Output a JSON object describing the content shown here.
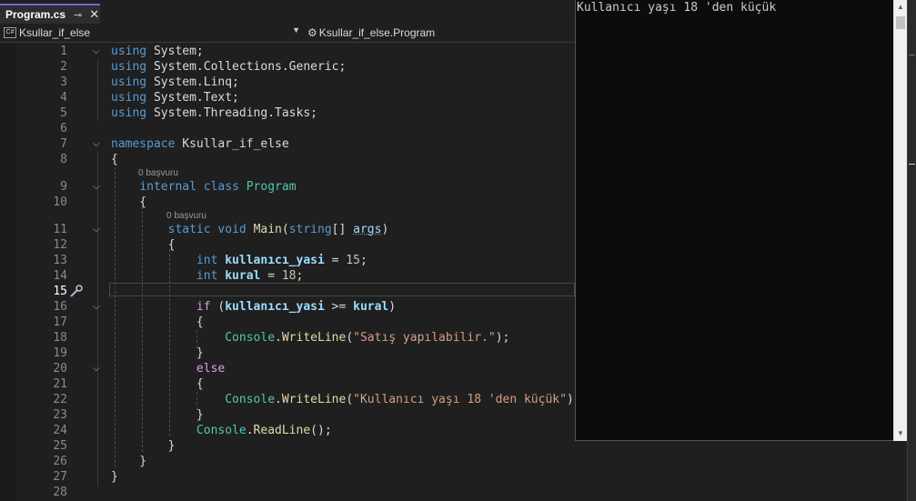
{
  "tab": {
    "title": "Program.cs",
    "pin_icon": "pin-icon",
    "close_label": "✕"
  },
  "nav": {
    "project": "Ksullar_if_else",
    "member": "Ksullar_if_else.Program"
  },
  "lens": {
    "refs": "0 başvuru"
  },
  "code": {
    "using": "using",
    "lines_using": [
      "System;",
      "System.Collections.Generic;",
      "System.Linq;",
      "System.Text;",
      "System.Threading.Tasks;"
    ],
    "namespace_kw": "namespace",
    "namespace_name": "Ksullar_if_else",
    "internal_kw": "internal",
    "class_kw": "class",
    "class_name": "Program",
    "static_kw": "static",
    "void_kw": "void",
    "main": "Main",
    "string_kw": "string",
    "args": "args",
    "int_kw": "int",
    "var1": "kullanıcı_yasi",
    "val1": "15",
    "var2": "kural",
    "val2": "18",
    "if_kw": "if",
    "op": ">=",
    "else_kw": "else",
    "console": "Console",
    "writeline": "WriteLine",
    "readline": "ReadLine",
    "str1": "\"Satış yapılabilir.\"",
    "str2": "\"Kullanıcı yaşı 18 'den küçük\""
  },
  "line_numbers": [
    "1",
    "2",
    "3",
    "4",
    "5",
    "6",
    "7",
    "8",
    "9",
    "10",
    "11",
    "12",
    "13",
    "14",
    "15",
    "16",
    "17",
    "18",
    "19",
    "20",
    "21",
    "22",
    "23",
    "24",
    "25",
    "26",
    "27",
    "28"
  ],
  "active_line": "15",
  "console": {
    "output": "Kullanıcı yaşı 18 'den küçük"
  },
  "colors": {
    "keyword": "#569cd6",
    "type": "#4ec9b0",
    "method": "#dcdcaa",
    "string": "#d69d85",
    "control": "#d8a0df",
    "accent": "#7f5fd6"
  }
}
